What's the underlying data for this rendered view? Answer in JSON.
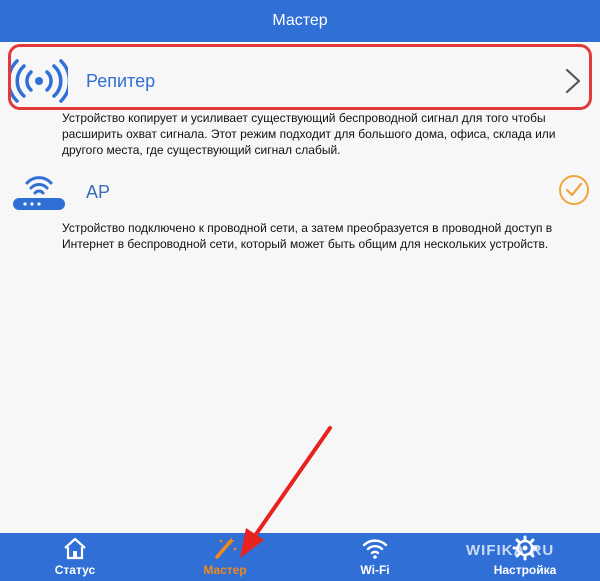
{
  "header": {
    "title": "Мастер"
  },
  "modes": [
    {
      "label": "Репитер",
      "description": "Устройство копирует и усиливает существующий беспроводной сигнал для того чтобы расширить охват сигнала. Этот режим подходит для большого дома, офиса, склада или другого места, где существующий сигнал слабый.",
      "icon": "wireless-signal-icon",
      "indicator": "chevron-right-icon"
    },
    {
      "label": "AP",
      "description": "Устройство подключено к проводной сети, а затем преобразуется в проводной доступ в Интернет в беспроводной сети, который может быть общим для нескольких устройств.",
      "icon": "router-wifi-icon",
      "indicator": "check-circle-icon"
    }
  ],
  "tabs": [
    {
      "label": "Статус",
      "icon": "home-icon",
      "active": false
    },
    {
      "label": "Мастер",
      "icon": "magic-wand-icon",
      "active": true
    },
    {
      "label": "Wi-Fi",
      "icon": "wifi-icon",
      "active": false
    },
    {
      "label": "Настройка",
      "icon": "gear-icon",
      "active": false
    }
  ],
  "watermark": "WIFIKA.RU",
  "colors": {
    "primary": "#2f6fd6",
    "accent": "#f28a1a",
    "highlight": "#e23a3a"
  }
}
